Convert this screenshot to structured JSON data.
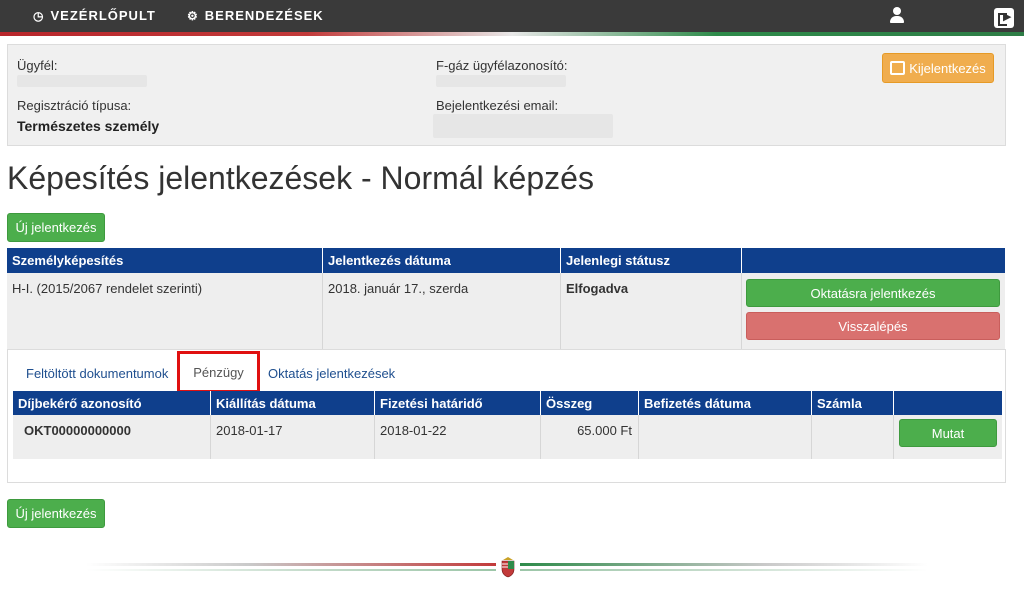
{
  "nav": {
    "dashboard_label": "VEZÉRLŐPULT",
    "devices_label": "BERENDEZÉSEK",
    "dashboard_icon": "dashboard-icon",
    "devices_icon": "gear-icon",
    "user_icon": "user-icon",
    "logout_icon": "logout-icon"
  },
  "client": {
    "client_label": "Ügyfél:",
    "fgas_id_label": "F-gáz ügyfélazonosító:",
    "reg_type_label": "Regisztráció típusa:",
    "reg_type_value": "Természetes személy",
    "login_email_label": "Bejelentkezési email:",
    "logout_button": "Kijelentkezés"
  },
  "page_title": "Képesítés jelentkezések - Normál képzés",
  "new_application_button": "Új jelentkezés",
  "main_table": {
    "headers": [
      "Személyképesítés",
      "Jelentkezés dátuma",
      "Jelenlegi státusz",
      ""
    ],
    "row": {
      "qualification": "H-I. (2015/2067 rendelet szerinti)",
      "date": "2018. január 17., szerda",
      "status": "Elfogadva",
      "enroll_button": "Oktatásra jelentkezés",
      "withdraw_button": "Visszalépés"
    }
  },
  "tabs": [
    {
      "label": "Feltöltött dokumentumok"
    },
    {
      "label": "Pénzügy",
      "active": true
    },
    {
      "label": "Oktatás jelentkezések"
    }
  ],
  "payment_table": {
    "headers": [
      "Díjbekérő azonosító",
      "Kiállítás dátuma",
      "Fizetési határidő",
      "Összeg",
      "Befizetés dátuma",
      "Számla",
      ""
    ],
    "row": {
      "id": "OKT00000000000",
      "issue_date": "2018-01-17",
      "due_date": "2018-01-22",
      "amount": "65.000 Ft",
      "paid_date": "",
      "invoice": "",
      "show_button": "Mutat"
    }
  },
  "bottom_new_application_button": "Új jelentkezés",
  "colors": {
    "nav_bg": "#3a3a3a",
    "table_header": "#0f3f8c",
    "green": "#4cae4c",
    "red": "#d9716f",
    "orange": "#f0ad4e",
    "highlight": "#e01010"
  }
}
